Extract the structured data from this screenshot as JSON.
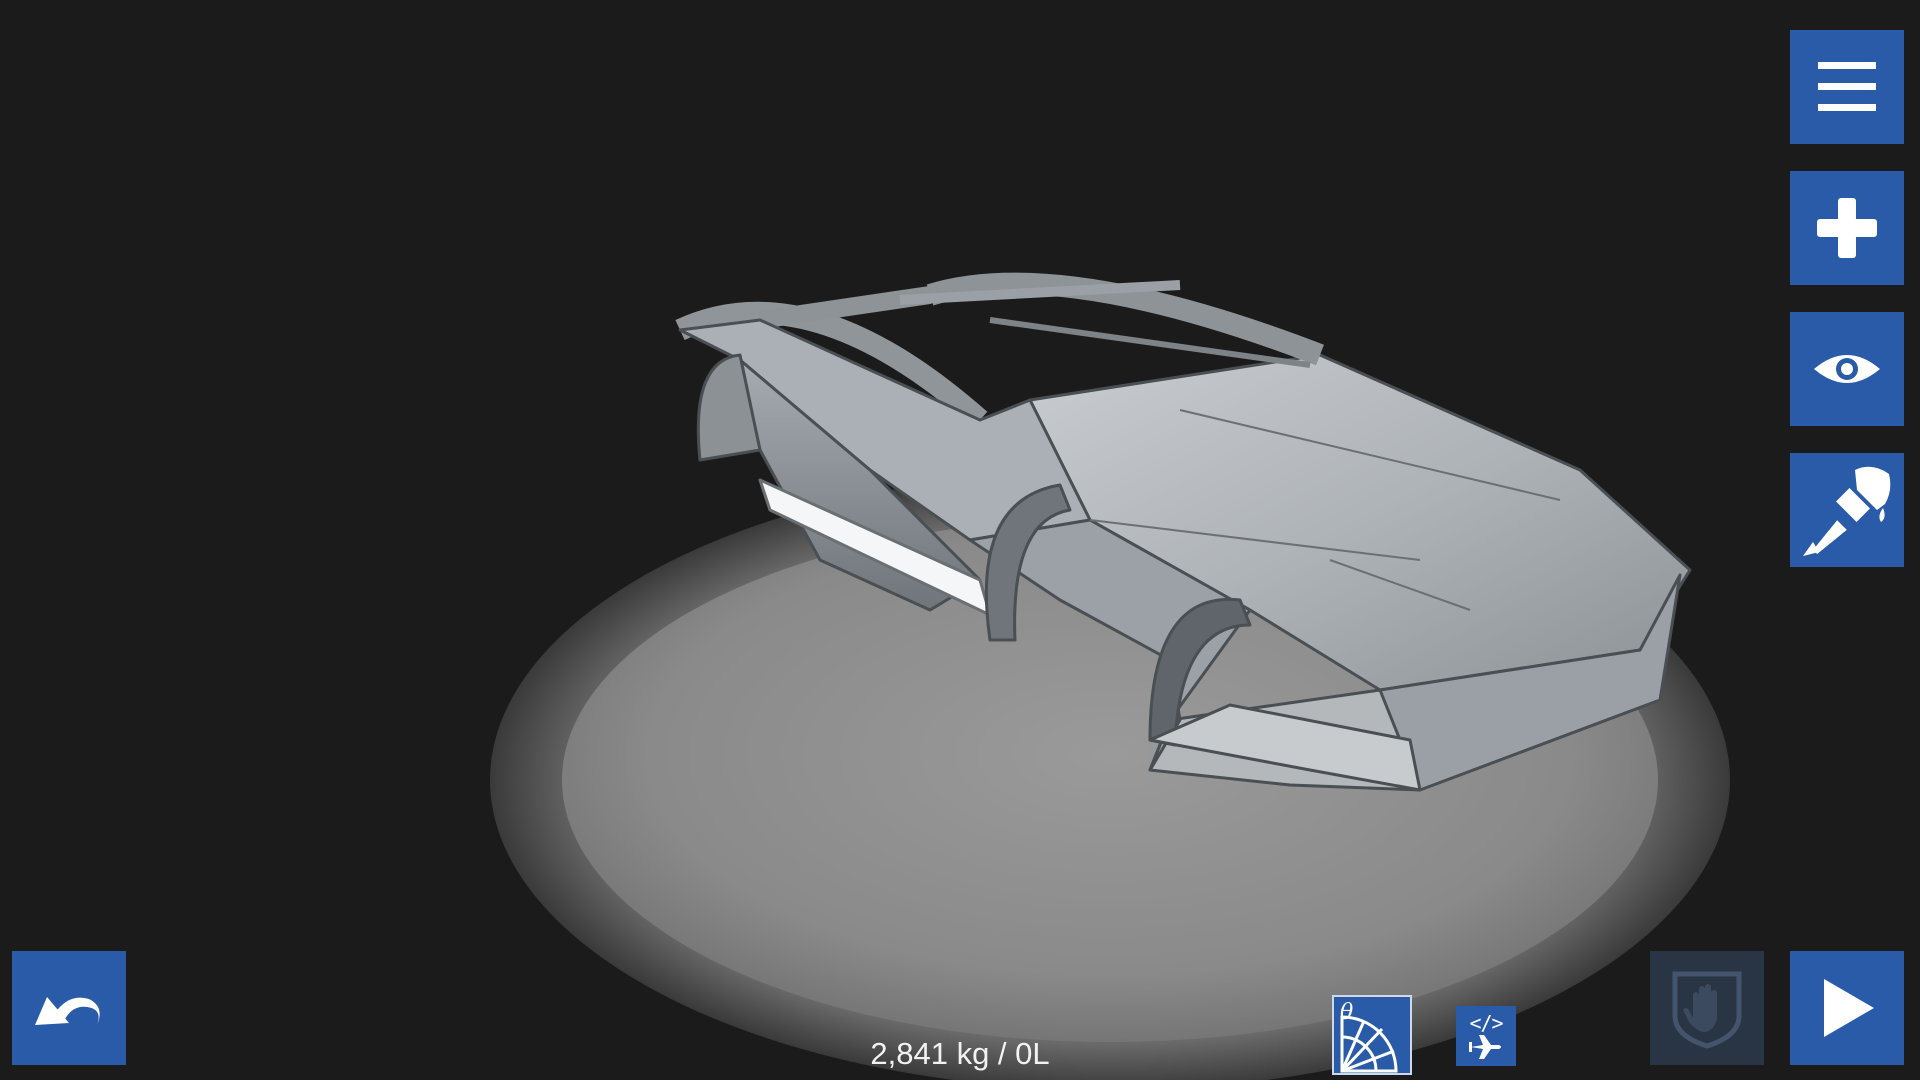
{
  "app": {
    "mode": "designer"
  },
  "toolbar_right": [
    {
      "id": "menu",
      "icon": "hamburger-menu-icon"
    },
    {
      "id": "add",
      "icon": "plus-icon"
    },
    {
      "id": "view",
      "icon": "eye-icon"
    },
    {
      "id": "paint",
      "icon": "paintbrush-icon"
    }
  ],
  "toolbar_bottom": {
    "undo_icon": "undo-arrow-icon",
    "angle_tool_icon": "protractor-angle-icon",
    "angle_symbol": "θ",
    "code_tool": {
      "glyph": "</>",
      "icon": "airplane-icon"
    },
    "grab_icon": "hand-shield-icon",
    "play_icon": "play-icon"
  },
  "status": {
    "mass_fuel": "2,841 kg / 0L"
  },
  "colors": {
    "button_blue": "#2a5ba8",
    "button_disabled": "#293444",
    "background": "#1b1b1b",
    "turntable": "#8a8a8a"
  }
}
